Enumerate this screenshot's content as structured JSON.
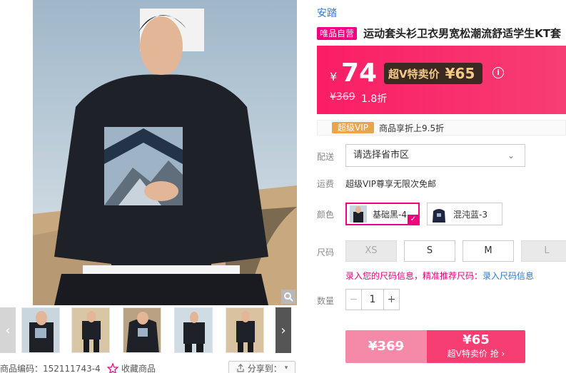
{
  "gallery": {
    "sku_code": "商品编码：152111743-4",
    "favorite_label": "收藏商品",
    "share_label": "分享到："
  },
  "product": {
    "brand": "安踏",
    "self_tag": "唯品自营",
    "title": "运动套头衫卫衣男宽松潮流舒适学生KT套",
    "currency": "¥",
    "price": "74",
    "svip_label": "超V特卖价",
    "svip_price": "¥65",
    "original_price": "¥369",
    "discount": "1.8折"
  },
  "vip": {
    "tag": "超级VIP",
    "desc": "商品享折上9.5折"
  },
  "delivery": {
    "label": "配送",
    "placeholder": "请选择省市区"
  },
  "shipping": {
    "label": "运费",
    "value": "超级VIP尊享无限次免邮"
  },
  "colors": {
    "label": "颜色",
    "options": [
      "基础黑-4",
      "混沌蓝-3"
    ]
  },
  "sizes": {
    "label": "尺码",
    "options": [
      "XS",
      "S",
      "M",
      "L"
    ],
    "hint": "录入您的尺码信息，精准推荐尺码：",
    "hint_link": "录入尺码信息"
  },
  "quantity": {
    "label": "数量",
    "minus": "−",
    "value": "1",
    "plus": "+"
  },
  "buy": {
    "orig_price": "¥369",
    "svip_price": "¥65",
    "svip_label": "超V特卖价 抢 ›"
  },
  "colors_theme": {
    "accent": "#f10180",
    "price_bg": "#fa1d66",
    "link": "#2c7bd6"
  }
}
